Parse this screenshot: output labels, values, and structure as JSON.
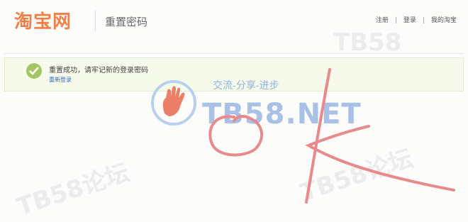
{
  "header": {
    "logo": "淘宝网",
    "title": "重置密码",
    "links": [
      "注册",
      "登录",
      "我的淘宝"
    ]
  },
  "success": {
    "message": "重置成功，请牢记新的登录密码",
    "relogin": "重新登录"
  },
  "watermark": {
    "slogan": "交流-分享-进步",
    "site": "TB58.NET"
  },
  "colors": {
    "logo": "#f47f46",
    "success_bg": "#f6faea",
    "check": "#a4c561",
    "link": "#3366cc",
    "scribble": "#e8898c"
  }
}
